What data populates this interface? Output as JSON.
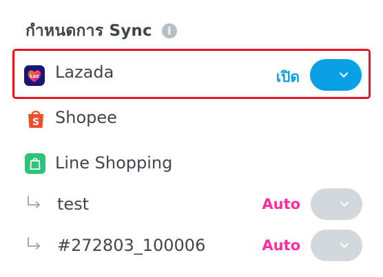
{
  "header": {
    "title": "กำหนดการ Sync",
    "info_icon": "info-circle-icon"
  },
  "colors": {
    "accent": "#0aa0e6",
    "auto": "#ff2ea0",
    "highlight_border": "#e8141c",
    "toggle_off": "#d3d8dd",
    "text": "#3f464e"
  },
  "channels": [
    {
      "name": "Lazada",
      "icon": "lazada-logo-icon",
      "status": "เปิด",
      "toggle": "on"
    },
    {
      "name": "Shopee",
      "icon": "shopee-bag-icon"
    },
    {
      "name": "Line Shopping",
      "icon": "line-shopping-bag-icon"
    }
  ],
  "sub_channels": [
    {
      "name": "test",
      "icon": "sub-item-arrow-icon",
      "status": "Auto",
      "toggle": "off"
    },
    {
      "name": "#272803_100006",
      "icon": "sub-item-arrow-icon",
      "status": "Auto",
      "toggle": "off"
    }
  ]
}
